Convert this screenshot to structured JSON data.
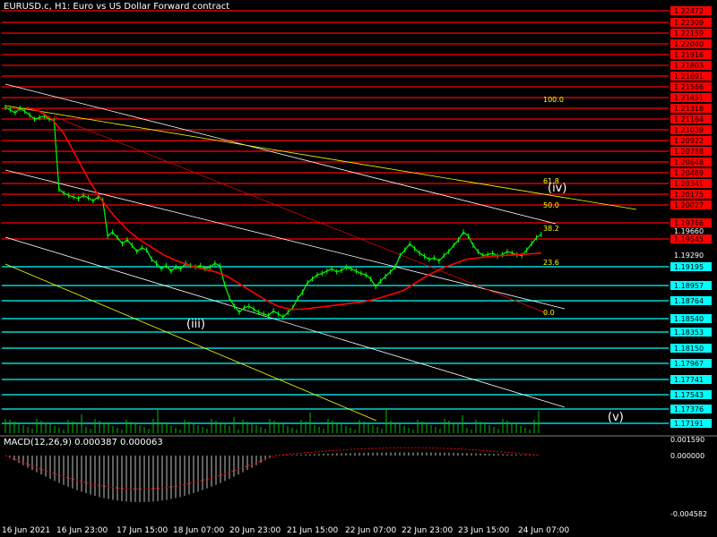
{
  "header": {
    "title": "EURUSD.c, H1:  Euro vs US Dollar Forward contract"
  },
  "macd": {
    "label": "MACD(12,26,9) 0.000387 0.000063"
  },
  "colors": {
    "background": "#000000",
    "candle": "#00ff00",
    "ma": "#ff0000",
    "resistance": "#ff0000",
    "support": "#00ffff",
    "fib": "#ffff00",
    "channel": "#ffffff",
    "volume": "#00c000",
    "macd_hist": "#c0c0c0",
    "macd_signal": "#ff0000"
  },
  "chart_data": {
    "type": "line",
    "symbol": "EURUSD.c",
    "timeframe": "H1",
    "price_axis_labels": [
      "1.22472",
      "1.22309",
      "1.22159",
      "1.22040",
      "1.21916",
      "1.21803",
      "1.21691",
      "1.21566",
      "1.21451",
      "1.21318",
      "1.21164",
      "1.21039",
      "1.20922",
      "1.20788",
      "1.20648",
      "1.20489",
      "1.20341",
      "1.20175",
      "1.20027",
      "1.19766",
      "1.19660",
      "1.19545",
      "1.19290",
      "1.19195",
      "1.18957",
      "1.18764",
      "1.18540",
      "1.18353",
      "1.18150",
      "1.17967",
      "1.17741",
      "1.17543",
      "1.17376",
      "1.17191"
    ],
    "resistance_levels": [
      "1.22472",
      "1.22309",
      "1.22159",
      "1.22040",
      "1.21916",
      "1.21803",
      "1.21691",
      "1.21566",
      "1.21451",
      "1.21318",
      "1.21164",
      "1.21039",
      "1.20922",
      "1.20788",
      "1.20648",
      "1.20489",
      "1.20341",
      "1.20175",
      "1.20027",
      "1.19766",
      "1.19545"
    ],
    "support_levels": [
      "1.19195",
      "1.18957",
      "1.18764",
      "1.18540",
      "1.18353",
      "1.18150",
      "1.17967",
      "1.17741",
      "1.17543",
      "1.17376",
      "1.17191"
    ],
    "current_price": "1.19660",
    "x_labels": [
      "16 Jun 2021",
      "16 Jun 23:00",
      "17 Jun 15:00",
      "18 Jun 07:00",
      "20 Jun 23:00",
      "21 Jun 15:00",
      "22 Jun 07:00",
      "22 Jun 23:00",
      "23 Jun 15:00",
      "24 Jun 07:00"
    ],
    "fib_labels": [
      "100.0",
      "61.8",
      "50.0",
      "38.2",
      "23.6",
      "0.0"
    ],
    "wave_labels": [
      "(iii)",
      "(iv)",
      "(v)"
    ],
    "series": [
      {
        "values": [
          1.2125,
          1.2122,
          1.2118,
          1.2124,
          1.212,
          1.2115,
          1.211,
          1.2112,
          1.2114,
          1.211,
          1.2108,
          1.202,
          1.2015,
          1.2012,
          1.201,
          1.2008,
          1.2012,
          1.2009,
          1.2005,
          1.201,
          1.2006,
          1.196,
          1.1965,
          1.1958,
          1.195,
          1.1955,
          1.1948,
          1.194,
          1.1945,
          1.1942,
          1.193,
          1.1925,
          1.1918,
          1.1922,
          1.1915,
          1.192,
          1.1918,
          1.1925,
          1.1922,
          1.192,
          1.1922,
          1.1918,
          1.192,
          1.1925,
          1.1922,
          1.1898,
          1.188,
          1.187,
          1.1862,
          1.1868,
          1.187,
          1.1866,
          1.1862,
          1.186,
          1.1858,
          1.1864,
          1.186,
          1.1856,
          1.1862,
          1.1868,
          1.188,
          1.1888,
          1.19,
          1.1905,
          1.191,
          1.1912,
          1.1915,
          1.1918,
          1.1914,
          1.1916,
          1.192,
          1.1918,
          1.1915,
          1.1912,
          1.191,
          1.1905,
          1.1895,
          1.1902,
          1.1908,
          1.1914,
          1.192,
          1.1935,
          1.1942,
          1.195,
          1.1944,
          1.1938,
          1.1934,
          1.193,
          1.1932,
          1.1928,
          1.1935,
          1.194,
          1.1948,
          1.1955,
          1.1965,
          1.196,
          1.1948,
          1.194,
          1.1935,
          1.1936,
          1.1938,
          1.1934,
          1.1936,
          1.194,
          1.1938,
          1.1936,
          1.1935,
          1.1942,
          1.195,
          1.1958,
          1.1962
        ]
      },
      {
        "values": [
          1.2125,
          1.212,
          1.211,
          1.209,
          1.206,
          1.203,
          1.2005,
          1.1985,
          1.1968,
          1.1955,
          1.1945,
          1.1935,
          1.1928,
          1.1922,
          1.1918,
          1.1914,
          1.1908,
          1.1898,
          1.1888,
          1.1878,
          1.187,
          1.1866,
          1.1866,
          1.1868,
          1.187,
          1.1872,
          1.1874,
          1.1876,
          1.188,
          1.1885,
          1.189,
          1.19,
          1.191,
          1.1918,
          1.1924,
          1.193,
          1.1932,
          1.1934,
          1.1935,
          1.1936,
          1.1937,
          1.1938
        ]
      }
    ]
  }
}
